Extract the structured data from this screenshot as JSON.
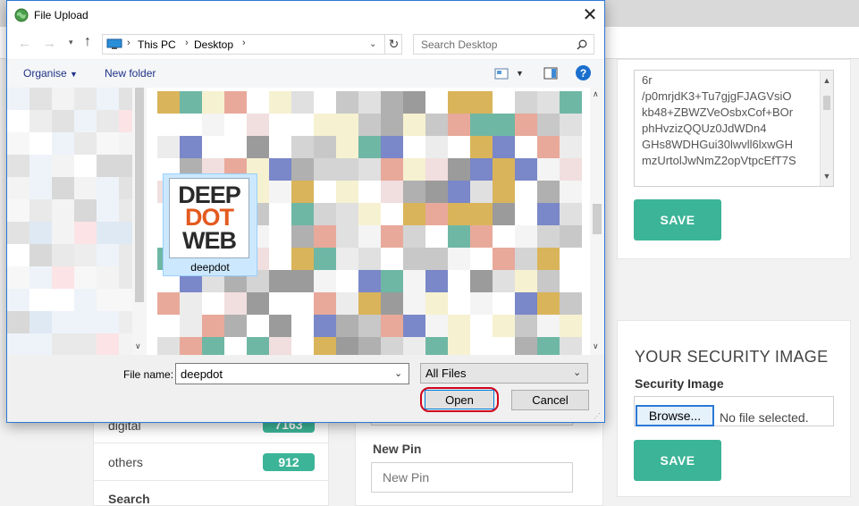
{
  "dialog": {
    "title": "File Upload",
    "breadcrumb": [
      "This PC",
      "Desktop"
    ],
    "search_placeholder": "Search Desktop",
    "organise_label": "Organise",
    "new_folder_label": "New folder",
    "selected_file": {
      "name": "deepdot",
      "logo_lines": [
        "DEEP",
        "DOT",
        "WEB"
      ]
    },
    "file_name_label": "File name:",
    "file_name_value": "deepdot",
    "file_type_value": "All Files",
    "open_label": "Open",
    "cancel_label": "Cancel",
    "help_glyph": "?"
  },
  "page": {
    "key_textarea_lines": [
      "6r",
      "/p0mrjdK3+Tu7gjgFJAGVsiO",
      "kb48+ZBWZVeOsbxCof+BOr",
      "phHvzizQQUz0JdWDn4",
      "GHs8WDHGui30lwvll6lxwGH",
      "mzUrtolJwNmZ2opVtpcEfT7S"
    ],
    "save_label_1": "SAVE",
    "security_heading": "YOUR SECURITY IMAGE",
    "security_image_label": "Security Image",
    "browse_label": "Browse...",
    "no_file_text": "No file selected.",
    "save_label_2": "SAVE",
    "categories": [
      {
        "name": "digital",
        "count": "7163"
      },
      {
        "name": "others",
        "count": "912"
      }
    ],
    "sidebar_search_label": "Search",
    "new_pin_label": "New Pin",
    "new_pin_placeholder": "New Pin"
  },
  "colors": {
    "accent_green": "#3cb497",
    "dialog_border": "#2b79d6",
    "selection_bg": "#cce8ff",
    "selection_border": "#99d1ff",
    "logo_orange": "#e35a1f",
    "open_highlight": "#d0021b"
  }
}
